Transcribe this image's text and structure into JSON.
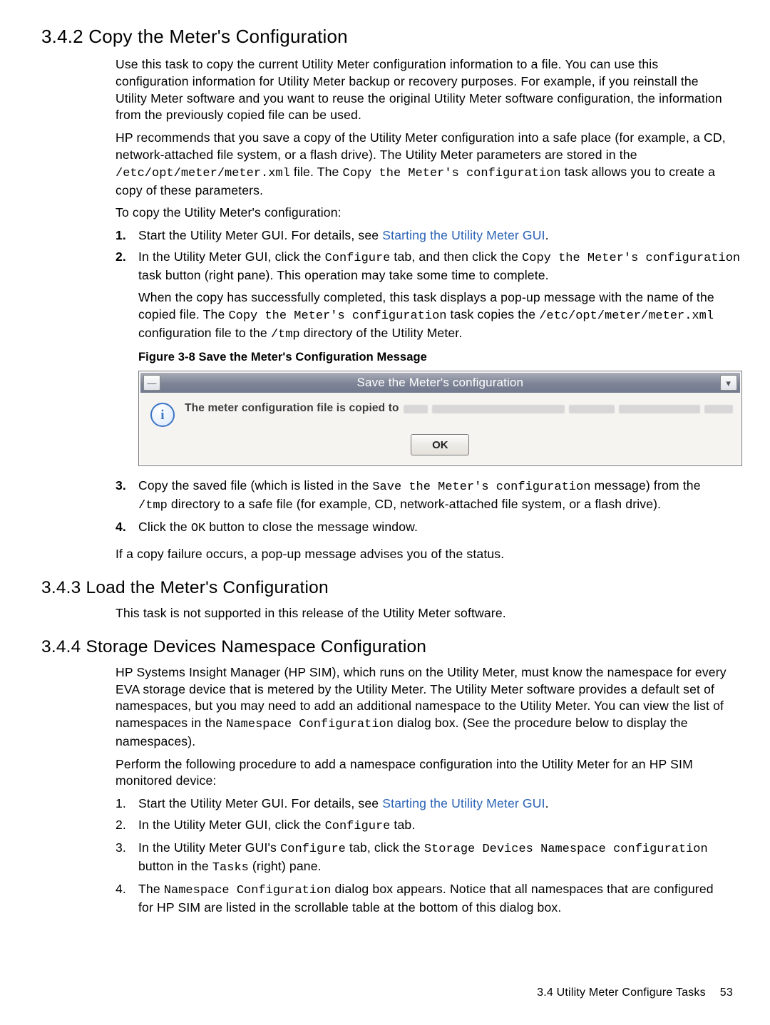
{
  "s342": {
    "heading": "3.4.2 Copy the Meter's Configuration",
    "p1": "Use this task to copy the current Utility Meter configuration information to a file. You can use this configuration information for Utility Meter backup or recovery purposes. For example, if you reinstall the Utility Meter software and you want to reuse the original Utility Meter software configuration, the information from the previously copied file can be used.",
    "p2a": "HP recommends that you save a copy of the Utility Meter configuration into a safe place (for example, a CD, network-attached file system, or a flash drive). The Utility Meter parameters are stored in the ",
    "p2path": "/etc/opt/meter/meter.xml",
    "p2b": " file. The ",
    "p2task": "Copy the Meter's configuration",
    "p2c": " task allows you to create a copy of these parameters.",
    "p3": "To copy the Utility Meter's configuration:",
    "step1a": "Start the Utility Meter GUI. For details, see ",
    "step1link": "Starting the Utility Meter GUI",
    "step1b": ".",
    "step2a": "In the Utility Meter GUI, click the ",
    "step2conf": "Configure",
    "step2b": " tab, and then click the ",
    "step2copy": "Copy the Meter's configuration",
    "step2c": " task button (right pane). This operation may take some time to complete.",
    "step2d": "When the copy has successfully completed, this task displays a pop-up message with the name of the copied file. The ",
    "step2copy2": "Copy the Meter's configuration",
    "step2e": " task copies the ",
    "step2path": "/etc/opt/meter/meter.xml",
    "step2f": " configuration file to the ",
    "step2tmp": "/tmp",
    "step2g": " directory of the Utility Meter.",
    "figcaption": "Figure 3-8 Save the Meter's Configuration Message",
    "dialog": {
      "title": "Save the Meter's configuration",
      "menu_glyph": "—",
      "close_glyph": "▾",
      "info_glyph": "i",
      "copied_label": "The meter configuration file is copied to",
      "ok": "OK"
    },
    "step3a": "Copy the saved file (which is listed in the ",
    "step3save": "Save the Meter's configuration",
    "step3b": " message) from the ",
    "step3tmp": "/tmp",
    "step3c": " directory to a safe file (for example, CD, network-attached file system, or a flash drive).",
    "step4a": "Click the ",
    "step4ok": "OK",
    "step4b": " button to close the message window.",
    "p_after": "If a copy failure occurs, a pop-up message advises you of the status."
  },
  "s343": {
    "heading": "3.4.3 Load the Meter's Configuration",
    "p1": "This task is not supported in this release of the Utility Meter software."
  },
  "s344": {
    "heading": "3.4.4 Storage Devices Namespace Configuration",
    "p1a": "HP Systems Insight Manager (HP SIM), which runs on the Utility Meter, must know the namespace for every EVA storage device that is metered by the Utility Meter. The Utility Meter software provides a default set of namespaces, but you may need to add an additional namespace to the Utility Meter. You can view the list of namespaces in the ",
    "p1code": "Namespace Configuration",
    "p1b": " dialog box. (See the procedure below to display the namespaces).",
    "p2": "Perform the following procedure to add a namespace configuration into the Utility Meter for an HP SIM monitored device:",
    "step1a": "Start the Utility Meter GUI. For details, see ",
    "step1link": "Starting the Utility Meter GUI",
    "step1b": ".",
    "step2a": "In the Utility Meter GUI, click the ",
    "step2conf": "Configure",
    "step2b": " tab.",
    "step3a": "In the Utility Meter GUI's ",
    "step3conf": "Configure",
    "step3b": " tab, click the ",
    "step3btn": "Storage Devices Namespace configuration",
    "step3c": " button in the ",
    "step3tasks": "Tasks",
    "step3d": " (right) pane.",
    "step4a": "The ",
    "step4code": "Namespace Configuration",
    "step4b": " dialog box appears. Notice that all namespaces that are configured for HP SIM are listed in the scrollable table at the bottom of this dialog box."
  },
  "footer": {
    "section": "3.4 Utility Meter Configure Tasks",
    "page": "53"
  }
}
